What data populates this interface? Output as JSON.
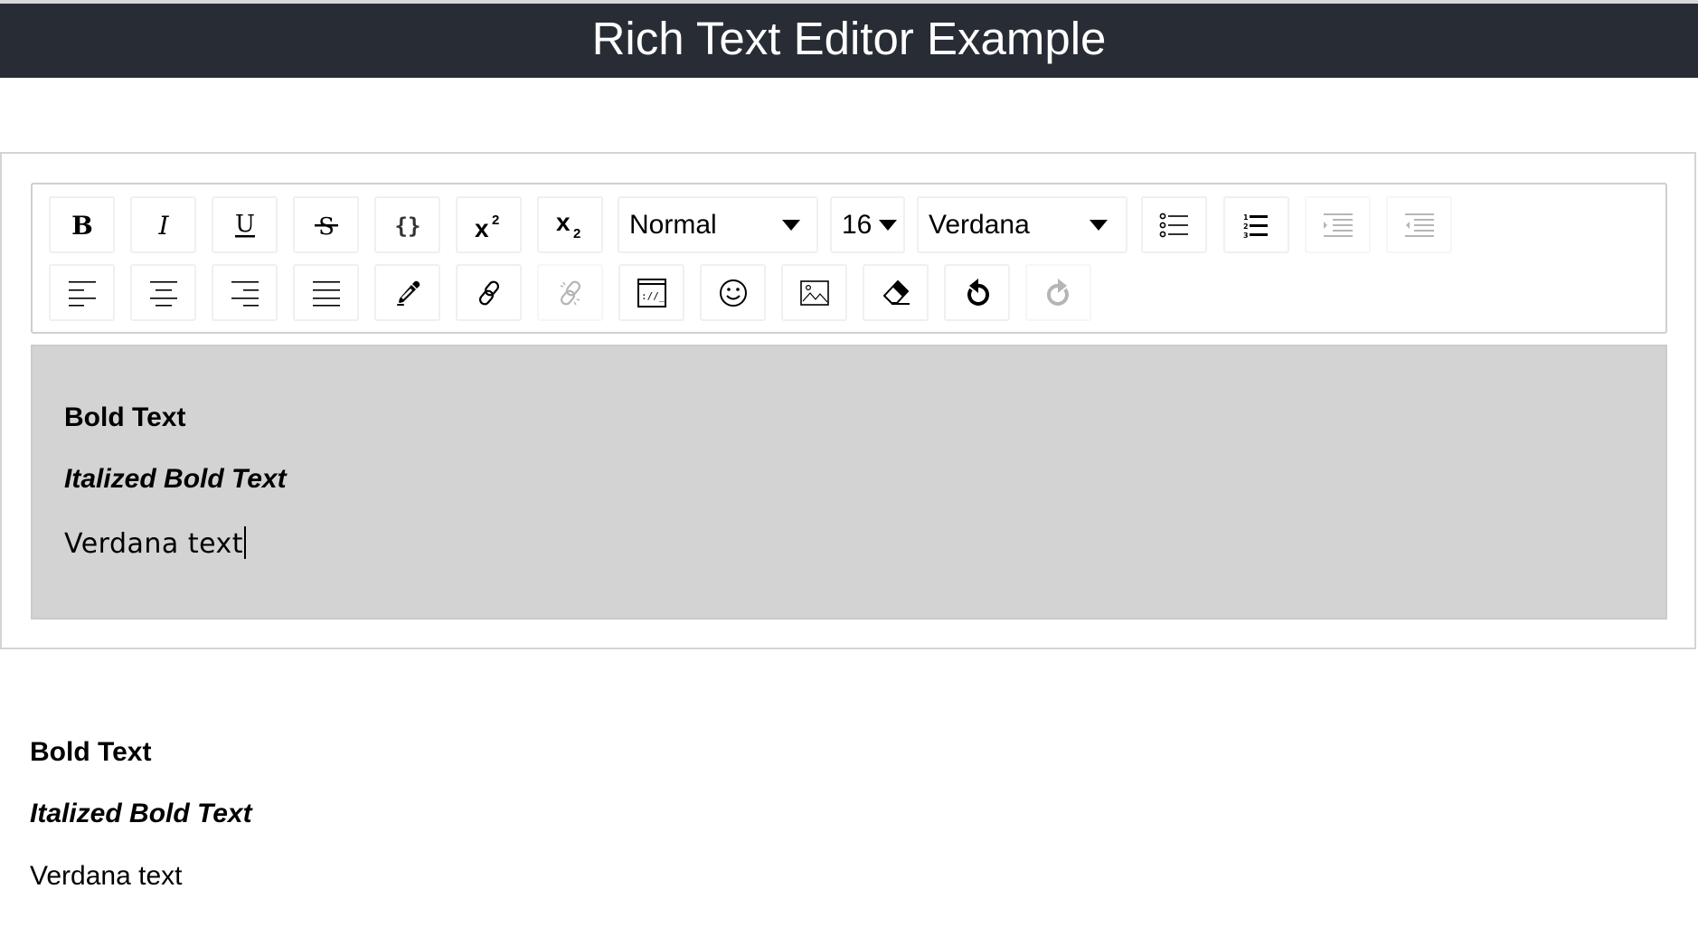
{
  "header": {
    "title": "Rich Text Editor Example"
  },
  "toolbar": {
    "row1": [
      {
        "name": "bold-button",
        "icon": "bold-icon",
        "label": "B",
        "disabled": false
      },
      {
        "name": "italic-button",
        "icon": "italic-icon",
        "label": "I",
        "disabled": false
      },
      {
        "name": "underline-button",
        "icon": "underline-icon",
        "label": "U",
        "disabled": false
      },
      {
        "name": "strikethrough-button",
        "icon": "strikethrough-icon",
        "label": "S",
        "disabled": false
      },
      {
        "name": "code-button",
        "icon": "code-braces-icon",
        "label": "{ }",
        "disabled": false
      },
      {
        "name": "superscript-button",
        "icon": "superscript-icon",
        "label": "x2",
        "disabled": false
      },
      {
        "name": "subscript-button",
        "icon": "subscript-icon",
        "label": "x2",
        "disabled": false
      }
    ],
    "block_type": {
      "value": "Normal"
    },
    "font_size": {
      "value": "16"
    },
    "font_family": {
      "value": "Verdana"
    },
    "row1_right": [
      {
        "name": "unordered-list-button",
        "icon": "bulleted-list-icon",
        "disabled": false
      },
      {
        "name": "ordered-list-button",
        "icon": "numbered-list-icon",
        "disabled": false
      },
      {
        "name": "indent-button",
        "icon": "indent-icon",
        "disabled": true
      },
      {
        "name": "outdent-button",
        "icon": "outdent-icon",
        "disabled": true
      }
    ],
    "row2": [
      {
        "name": "align-left-button",
        "icon": "align-left-icon",
        "disabled": false
      },
      {
        "name": "align-center-button",
        "icon": "align-center-icon",
        "disabled": false
      },
      {
        "name": "align-right-button",
        "icon": "align-right-icon",
        "disabled": false
      },
      {
        "name": "align-justify-button",
        "icon": "align-justify-icon",
        "disabled": false
      },
      {
        "name": "color-picker-button",
        "icon": "eyedropper-icon",
        "disabled": false
      },
      {
        "name": "link-button",
        "icon": "link-icon",
        "disabled": false
      },
      {
        "name": "unlink-button",
        "icon": "unlink-icon",
        "disabled": true
      },
      {
        "name": "embed-button",
        "icon": "embed-icon",
        "disabled": false
      },
      {
        "name": "emoji-button",
        "icon": "emoji-icon",
        "disabled": false
      },
      {
        "name": "image-button",
        "icon": "image-icon",
        "disabled": false
      },
      {
        "name": "remove-format-button",
        "icon": "eraser-icon",
        "disabled": false
      },
      {
        "name": "undo-button",
        "icon": "undo-icon",
        "disabled": false
      },
      {
        "name": "redo-button",
        "icon": "redo-icon",
        "disabled": true
      }
    ]
  },
  "editor": {
    "lines": [
      "Bold Text",
      "Italized Bold Text",
      "Verdana text"
    ]
  },
  "output": {
    "lines": [
      "Bold Text",
      "Italized Bold Text",
      "Verdana text"
    ]
  },
  "colors": {
    "header_bg": "#282c34",
    "editor_bg": "#d3d3d3",
    "disabled_icon": "#b5b5b5"
  }
}
